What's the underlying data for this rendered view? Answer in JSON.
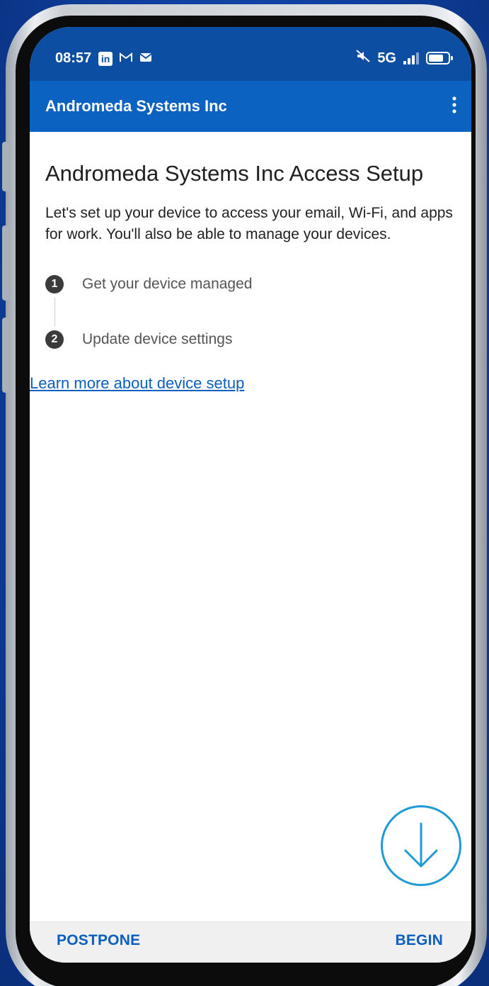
{
  "status_bar": {
    "time": "08:57",
    "notification_icons": [
      "linkedin-icon",
      "gmail-icon",
      "mail-icon"
    ],
    "network": "5G",
    "right_icons": [
      "mute-icon",
      "signal-icon",
      "battery-icon"
    ]
  },
  "app_bar": {
    "title": "Andromeda Systems Inc",
    "menu_icon": "more-vert-icon"
  },
  "main": {
    "title": "Andromeda Systems Inc Access Setup",
    "intro": "Let's set up your device to access your email, Wi-Fi, and apps for work. You'll also be able to manage your devices.",
    "steps": [
      {
        "number": "1",
        "label": "Get your device managed"
      },
      {
        "number": "2",
        "label": "Update device settings"
      }
    ],
    "learn_more_link": "Learn more about device setup"
  },
  "actions": {
    "postpone": "POSTPONE",
    "begin": "BEGIN"
  },
  "colors": {
    "status_bar": "#0b4ea2",
    "app_bar": "#0b62c1",
    "link": "#0a5fbf",
    "fab_outline": "#1f9ad6"
  }
}
